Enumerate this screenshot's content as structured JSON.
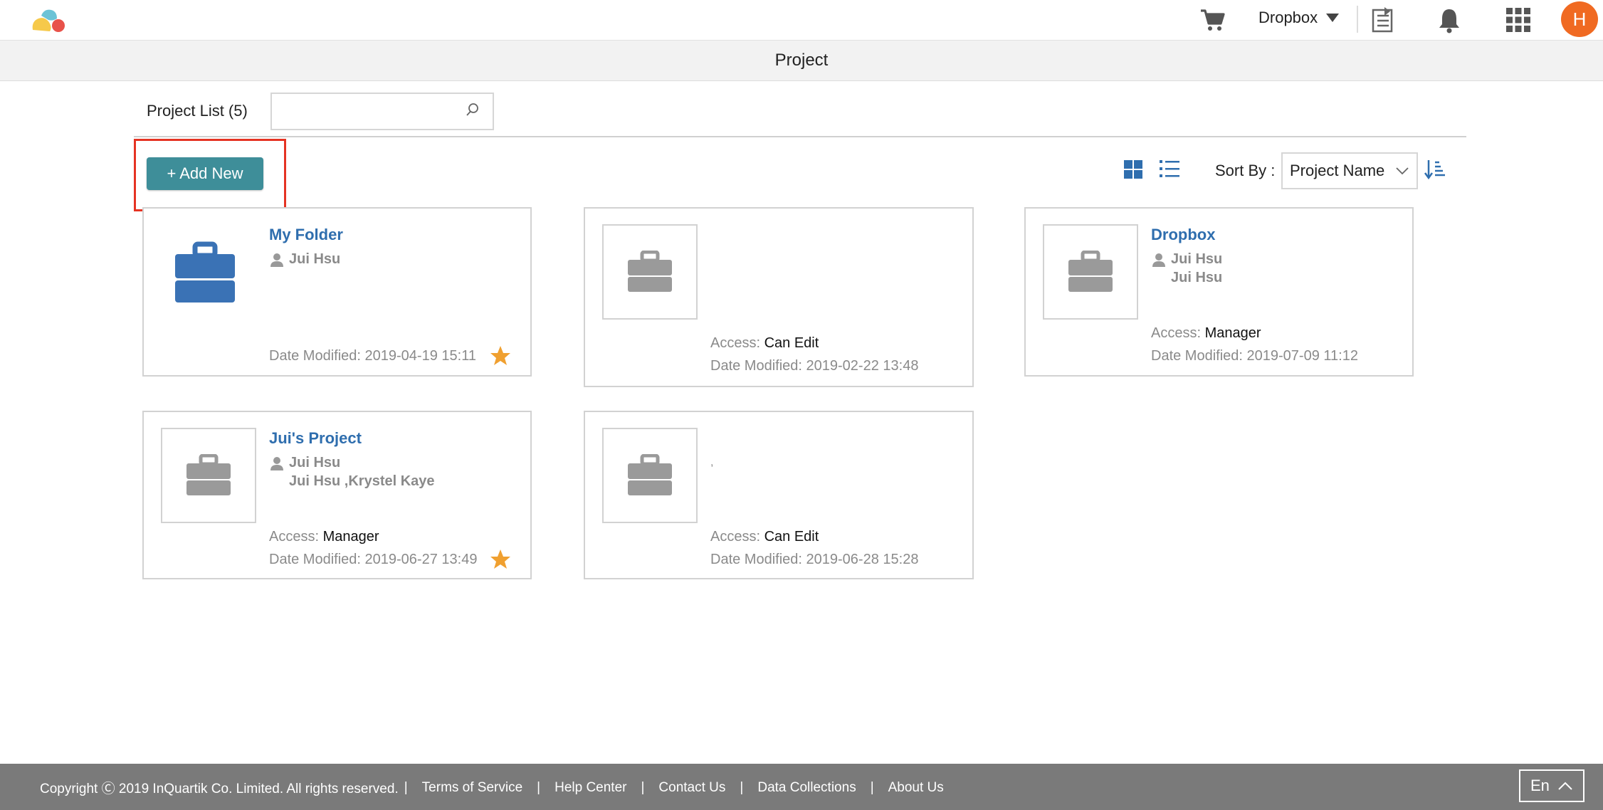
{
  "header": {
    "storage_selector": "Dropbox",
    "avatar_initial": "H"
  },
  "page": {
    "title": "Project"
  },
  "toolbar": {
    "list_label": "Project List (5)",
    "search_value": "",
    "add_new_label": "+ Add New",
    "sort_label": "Sort By :",
    "sort_value": "Project Name"
  },
  "projects": [
    {
      "name": "My Folder",
      "owner": "Jui Hsu",
      "date_label": "Date Modified:",
      "date": "2019-04-19 15:11",
      "starred": true,
      "icon": "briefcase-icon-blue"
    },
    {
      "name": "",
      "access_label": "Access:",
      "access": "Can Edit",
      "date_label": "Date Modified:",
      "date": "2019-02-22 13:48",
      "icon": "briefcase-icon-gray"
    },
    {
      "name": "Dropbox",
      "owner": "Jui Hsu",
      "members": "Jui Hsu",
      "access_label": "Access:",
      "access": "Manager",
      "date_label": "Date Modified:",
      "date": "2019-07-09 11:12",
      "icon": "briefcase-icon-gray"
    },
    {
      "name": "Jui's Project",
      "owner": "Jui Hsu",
      "members": "Jui Hsu ,Krystel Kaye",
      "access_label": "Access:",
      "access": "Manager",
      "date_label": "Date Modified:",
      "date": "2019-06-27 13:49",
      "starred": true,
      "icon": "briefcase-icon-gray"
    },
    {
      "name": "",
      "note": ",",
      "access_label": "Access:",
      "access": "Can Edit",
      "date_label": "Date Modified:",
      "date": "2019-06-28 15:28",
      "icon": "briefcase-icon-gray"
    }
  ],
  "footer": {
    "copyright": "Copyright Ⓒ 2019 InQuartik Co. Limited. All rights reserved.",
    "links": [
      "Terms of Service",
      "Help Center",
      "Contact Us",
      "Data Collections",
      "About Us"
    ],
    "language": "En"
  },
  "colors": {
    "accent_button": "#3e8e99",
    "link_blue": "#2f6eae",
    "highlight_red": "#e53323",
    "star": "#f0a030",
    "avatar": "#f06a22",
    "footer": "#7a7a7a"
  }
}
